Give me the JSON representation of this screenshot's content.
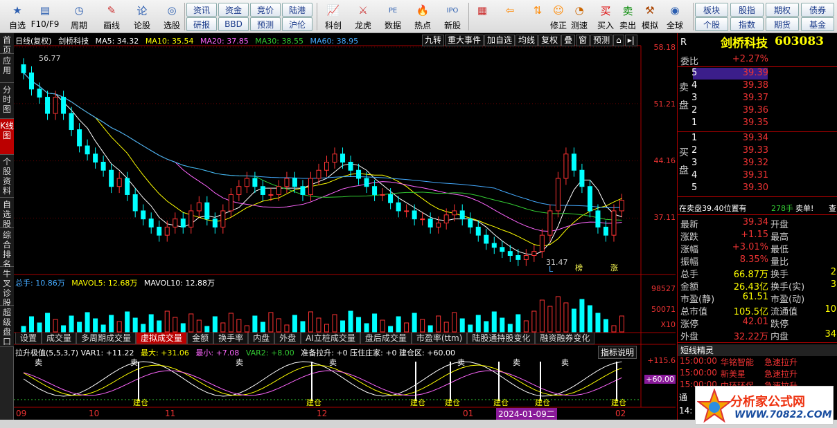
{
  "toolbar": {
    "buttons": [
      {
        "label": "自选",
        "icon": "star-icon"
      },
      {
        "label": "F10/F9",
        "icon": "f10-icon"
      },
      {
        "label": "周期",
        "icon": "clock-icon"
      },
      {
        "label": "画线",
        "icon": "pencil-icon"
      },
      {
        "label": "论股",
        "icon": "forum-icon"
      },
      {
        "label": "选股",
        "icon": "stock-picker-icon"
      }
    ],
    "small_buttons": [
      "资讯",
      "资金",
      "竞价",
      "陆港",
      "研报",
      "BBD",
      "预测",
      "沪伦"
    ],
    "buttons2": [
      {
        "label": "科创",
        "icon": "chart-icon"
      },
      {
        "label": "龙虎",
        "icon": "dragon-tiger-icon"
      },
      {
        "label": "数据",
        "icon": "pe-data-icon"
      },
      {
        "label": "热点",
        "icon": "hot-icon"
      },
      {
        "label": "新股",
        "icon": "ipo-icon"
      }
    ],
    "buttons3": [
      {
        "label": "",
        "icon": "color-grid-icon"
      },
      {
        "label": "",
        "icon": "arrow-left-icon"
      },
      {
        "label": "",
        "icon": "arrow-up-down-icon"
      },
      {
        "label": "修正",
        "icon": "fix-icon"
      },
      {
        "label": "测速",
        "icon": "speed-icon"
      },
      {
        "label": "买入",
        "icon": "buy-icon"
      },
      {
        "label": "卖出",
        "icon": "sell-icon"
      },
      {
        "label": "模拟",
        "icon": "hammer-icon"
      },
      {
        "label": "全球",
        "icon": "globe-icon"
      }
    ],
    "right_buttons": [
      "板块",
      "股指",
      "期权",
      "债券",
      "个股",
      "指数",
      "期货",
      "基金"
    ]
  },
  "left_tabs": [
    "首页",
    "应用",
    "分时图",
    "K线图",
    "个股资料",
    "自选股",
    "综合排名",
    "牛叉诊股",
    "超级盘口"
  ],
  "chart": {
    "period_label": "日线(复权)",
    "stock_name": "剑桥科技",
    "ma": [
      {
        "label": "MA5: 34.32",
        "color": "#ffffff"
      },
      {
        "label": "MA10: 35.54",
        "color": "#ffff00"
      },
      {
        "label": "MA20: 37.85",
        "color": "#ff66ff"
      },
      {
        "label": "MA30: 38.55",
        "color": "#33cc33"
      },
      {
        "label": "MA60: 38.95",
        "color": "#44aaff"
      }
    ],
    "tools": [
      "九转",
      "重大事件",
      "加自选",
      "均线",
      "复权",
      "叠",
      "窗",
      "预测"
    ],
    "price_ticks": [
      "58.18",
      "51.21",
      "44.16",
      "37.11"
    ],
    "high_label": "56.77",
    "low_label": "31.47",
    "marker_bang": "榜",
    "marker_zhang": "涨",
    "marker_l": "L",
    "volume_label": "总手: 10.86万",
    "mavol5": "MAVOL5: 12.68万",
    "mavol10": "MAVOL10: 12.88万",
    "volume_ticks": [
      "98527",
      "50071",
      "X10"
    ],
    "sub_tabs": [
      "设置",
      "成交量",
      "多周期成交量",
      "虚拟成交量",
      "金额",
      "换手率",
      "内盘",
      "外盘",
      "AI立桩成交量",
      "盘后成交量",
      "市盈率(ttm)",
      "陆股通持股变化",
      "融资融券变化"
    ],
    "sub_tab_active": "虚拟成交量",
    "indicator_line": "拉升极值(5,5,3,7) VAR1: +11.22",
    "indicator_max": "最大: +31.06",
    "indicator_min": "最小: +7.08",
    "indicator_var2": "VAR2: +8.00",
    "indicator_rest": "准备拉升: +0  压住庄家: +0  建仓区: +60.00",
    "indicator_help": "指标说明",
    "indicator_ticks": [
      "+115.6",
      "+60.00"
    ],
    "sell_mark": "卖",
    "build_mark": "建仓",
    "x_labels": [
      "09",
      "10",
      "11",
      "12",
      "01",
      "02"
    ],
    "x_selected": "2024-01-09二"
  },
  "quote": {
    "name": "剑桥科技",
    "code": "603083",
    "r_label": "R",
    "weibi_label": "委比",
    "weibi_value": "+2.27%",
    "sell_side_label": "卖盘",
    "buy_side_label": "买盘",
    "sells": [
      {
        "level": "5",
        "price": "39.39"
      },
      {
        "level": "4",
        "price": "39.38"
      },
      {
        "level": "3",
        "price": "39.37"
      },
      {
        "level": "2",
        "price": "39.36"
      },
      {
        "level": "1",
        "price": "39.35"
      }
    ],
    "buys": [
      {
        "level": "1",
        "price": "39.34"
      },
      {
        "level": "2",
        "price": "39.33"
      },
      {
        "level": "3",
        "price": "39.32"
      },
      {
        "level": "4",
        "price": "39.31"
      },
      {
        "level": "5",
        "price": "39.30"
      }
    ],
    "big_order_text": "在卖盘39.40位置有",
    "big_order_qty": "278手",
    "big_order_tail": "卖单!",
    "big_order_link": "查",
    "stats": [
      {
        "l": "最新",
        "v": "39.34",
        "l2": "开盘",
        "v2": ""
      },
      {
        "l": "涨跌",
        "v": "+1.15",
        "l2": "最高",
        "v2": ""
      },
      {
        "l": "涨幅",
        "v": "+3.01%",
        "l2": "最低",
        "v2": ""
      },
      {
        "l": "振幅",
        "v": "8.35%",
        "l2": "量比",
        "v2": ""
      },
      {
        "l": "总手",
        "v": "66.87万",
        "l2": "换手",
        "v2": "2"
      },
      {
        "l": "金额",
        "v": "26.43亿",
        "l2": "换手(实)",
        "v2": "3"
      },
      {
        "l": "市盈(静)",
        "v": "61.51",
        "l2": "市盈(动)",
        "v2": ""
      },
      {
        "l": "总市值",
        "v": "105.5亿",
        "l2": "流通值",
        "v2": "10"
      },
      {
        "l": "涨停",
        "v": "42.01",
        "l2": "跌停",
        "v2": ""
      },
      {
        "l": "外盘",
        "v": "32.22万",
        "l2": "内盘",
        "v2": "34"
      }
    ],
    "short_title": "短线精灵",
    "shorts": [
      {
        "time": "15:00:00",
        "name": "华铭智能",
        "event": "急速拉升"
      },
      {
        "time": "15:00:00",
        "name": "新美星",
        "event": "急速拉升"
      },
      {
        "time": "15:00:00",
        "name": "中环环保",
        "event": "急速拉升"
      }
    ],
    "footer_tongxin": "通",
    "footer_14": "14:"
  },
  "logo": {
    "title": "分析家公式网",
    "url": "WWW.70822.COM"
  },
  "colors": {
    "up": "#ff3333",
    "down": "#00ffff",
    "accent": "#aa0000"
  }
}
